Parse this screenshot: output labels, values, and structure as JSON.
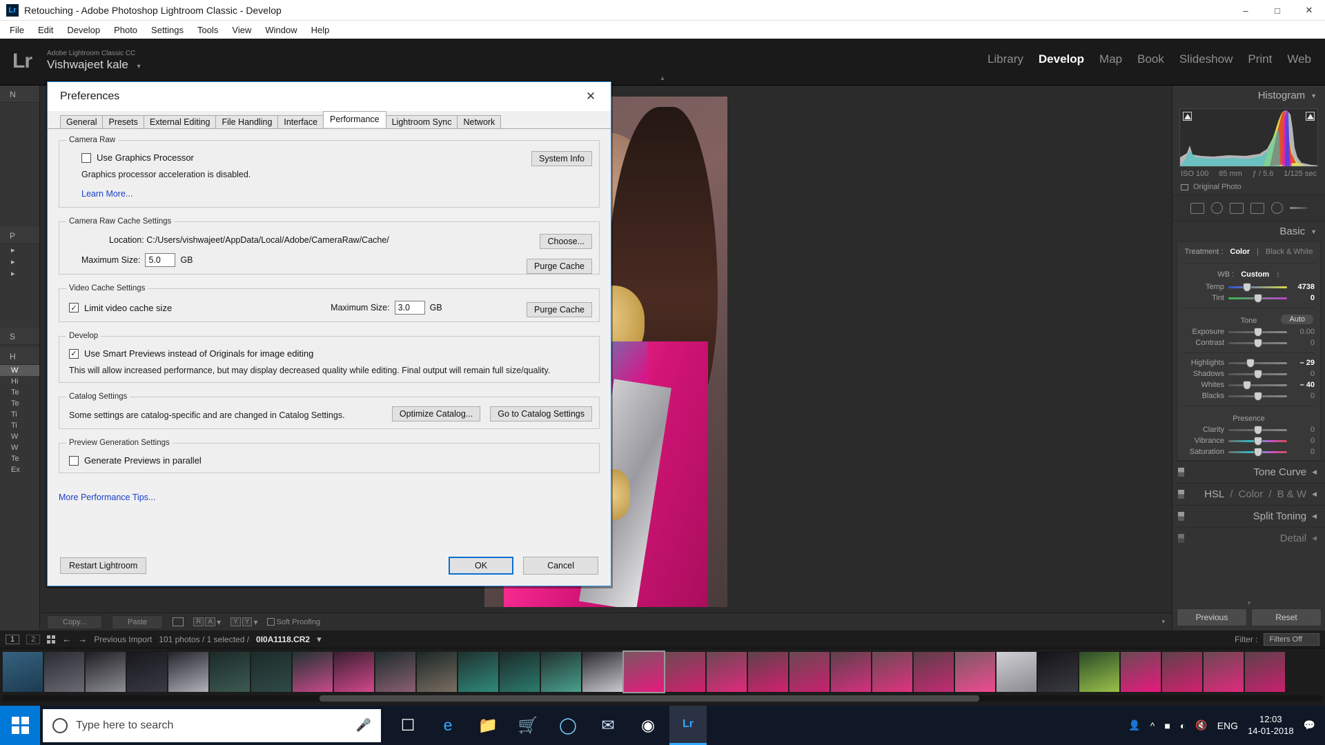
{
  "window": {
    "title": "Retouching - Adobe Photoshop Lightroom Classic - Develop",
    "app_badge": "Lr",
    "minimize": "–",
    "maximize": "□",
    "close": "✕"
  },
  "menubar": {
    "items": [
      "File",
      "Edit",
      "Develop",
      "Photo",
      "Settings",
      "Tools",
      "View",
      "Window",
      "Help"
    ]
  },
  "lightroom": {
    "logo": "Lr",
    "identity_line1": "Adobe Lightroom Classic CC",
    "identity_line2": "Vishwajeet kale",
    "identity_caret": "▼",
    "modules": [
      "Library",
      "Develop",
      "Map",
      "Book",
      "Slideshow",
      "Print",
      "Web"
    ],
    "active_module": "Develop"
  },
  "left_panel": {
    "navigator_header": "N",
    "groups": [
      {
        "label": "P",
        "rows": [
          "",
          "",
          ""
        ]
      },
      {
        "label": "S",
        "rows": []
      },
      {
        "label": "H",
        "rows": [
          "W",
          "Hi",
          "Te",
          "Te",
          "Ti",
          "Ti",
          "W",
          "W",
          "Te",
          "Ex"
        ]
      }
    ],
    "selected_row": "W"
  },
  "right_panel": {
    "histogram": {
      "title": "Histogram",
      "collapse_caret": "▼",
      "iso": "ISO 100",
      "focal": "85 mm",
      "aperture": "ƒ / 5.6",
      "shutter": "1/125 sec",
      "original_photo": "Original Photo"
    },
    "basic": {
      "title": "Basic",
      "collapse_caret": "▼",
      "treatment_label": "Treatment :",
      "treatment_color": "Color",
      "treatment_sep": "|",
      "treatment_bw": "Black & White",
      "wb_label": "WB :",
      "wb_value": "Custom",
      "wb_caret": "↕",
      "temp_label": "Temp",
      "temp_value": "4738",
      "tint_label": "Tint",
      "tint_value": "0",
      "tone_label": "Tone",
      "auto_label": "Auto",
      "exposure_label": "Exposure",
      "exposure_value": "0.00",
      "contrast_label": "Contrast",
      "contrast_value": "0",
      "highlights_label": "Highlights",
      "highlights_value": "– 29",
      "shadows_label": "Shadows",
      "shadows_value": "0",
      "whites_label": "Whites",
      "whites_value": "– 40",
      "blacks_label": "Blacks",
      "blacks_value": "0",
      "presence_label": "Presence",
      "clarity_label": "Clarity",
      "clarity_value": "0",
      "vibrance_label": "Vibrance",
      "vibrance_value": "0",
      "saturation_label": "Saturation",
      "saturation_value": "0"
    },
    "collapsed_panels": [
      {
        "title": "Tone Curve",
        "caret": "◀"
      },
      {
        "title": "HSL",
        "sep1": "/",
        "title2": "Color",
        "sep2": "/",
        "title3": "B & W",
        "caret": "◀"
      },
      {
        "title": "Split Toning",
        "caret": "◀"
      },
      {
        "title": "Detail",
        "caret": "◀"
      }
    ],
    "footer": {
      "previous": "Previous",
      "reset": "Reset",
      "caret": "▾"
    }
  },
  "develop_toolbar": {
    "copy": "Copy...",
    "paste": "Paste",
    "ra_left": "R",
    "ra_right": "A",
    "yy_left": "Y",
    "yy_right": "Y",
    "soft_proofing": "Soft Proofing",
    "caret": "▾"
  },
  "filmstrip": {
    "display1": "1",
    "display2": "2",
    "back_arrow": "←",
    "forward_arrow": "→",
    "source": "Previous Import",
    "count": "101 photos / 1 selected /",
    "filename": "0I0A1118.CR2",
    "caret": "▾",
    "filter_label": "Filter :",
    "filter_value": "Filters Off"
  },
  "taskbar": {
    "search_placeholder": "Type here to search",
    "language": "ENG",
    "time": "12:03",
    "date": "14-01-2018",
    "icons": [
      "task-view",
      "edge",
      "file-explorer",
      "store",
      "compass",
      "mail",
      "chrome",
      "lightroom"
    ]
  },
  "dialog": {
    "title": "Preferences",
    "close": "✕",
    "tabs": [
      "General",
      "Presets",
      "External Editing",
      "File Handling",
      "Interface",
      "Performance",
      "Lightroom Sync",
      "Network"
    ],
    "active_tab": "Performance",
    "camera_raw": {
      "legend": "Camera Raw",
      "use_gpu_label": "Use Graphics Processor",
      "use_gpu_checked": false,
      "status": "Graphics processor acceleration is disabled.",
      "learn_more": "Learn More...",
      "system_info_button": "System Info"
    },
    "camera_raw_cache": {
      "legend": "Camera Raw Cache Settings",
      "location_label": "Location:",
      "location_value": "C:/Users/vishwajeet/AppData/Local/Adobe/CameraRaw/Cache/",
      "choose_button": "Choose...",
      "max_size_label": "Maximum Size:",
      "max_size_value": "5.0",
      "unit": "GB",
      "purge_button": "Purge Cache"
    },
    "video_cache": {
      "legend": "Video Cache Settings",
      "limit_label": "Limit video cache size",
      "limit_checked": true,
      "max_size_label": "Maximum Size:",
      "max_size_value": "3.0",
      "unit": "GB",
      "purge_button": "Purge Cache"
    },
    "develop": {
      "legend": "Develop",
      "smart_previews_label": "Use Smart Previews instead of Originals for image editing",
      "smart_previews_checked": true,
      "note": "This will allow increased performance, but may display decreased quality while editing. Final output will remain full size/quality."
    },
    "catalog": {
      "legend": "Catalog Settings",
      "note": "Some settings are catalog-specific and are changed in Catalog Settings.",
      "optimize_button": "Optimize Catalog...",
      "goto_button": "Go to Catalog Settings"
    },
    "preview_generation": {
      "legend": "Preview Generation Settings",
      "parallel_label": "Generate Previews in parallel",
      "parallel_checked": false
    },
    "more_tips": "More Performance Tips...",
    "footer": {
      "restart": "Restart Lightroom",
      "ok": "OK",
      "cancel": "Cancel"
    }
  }
}
